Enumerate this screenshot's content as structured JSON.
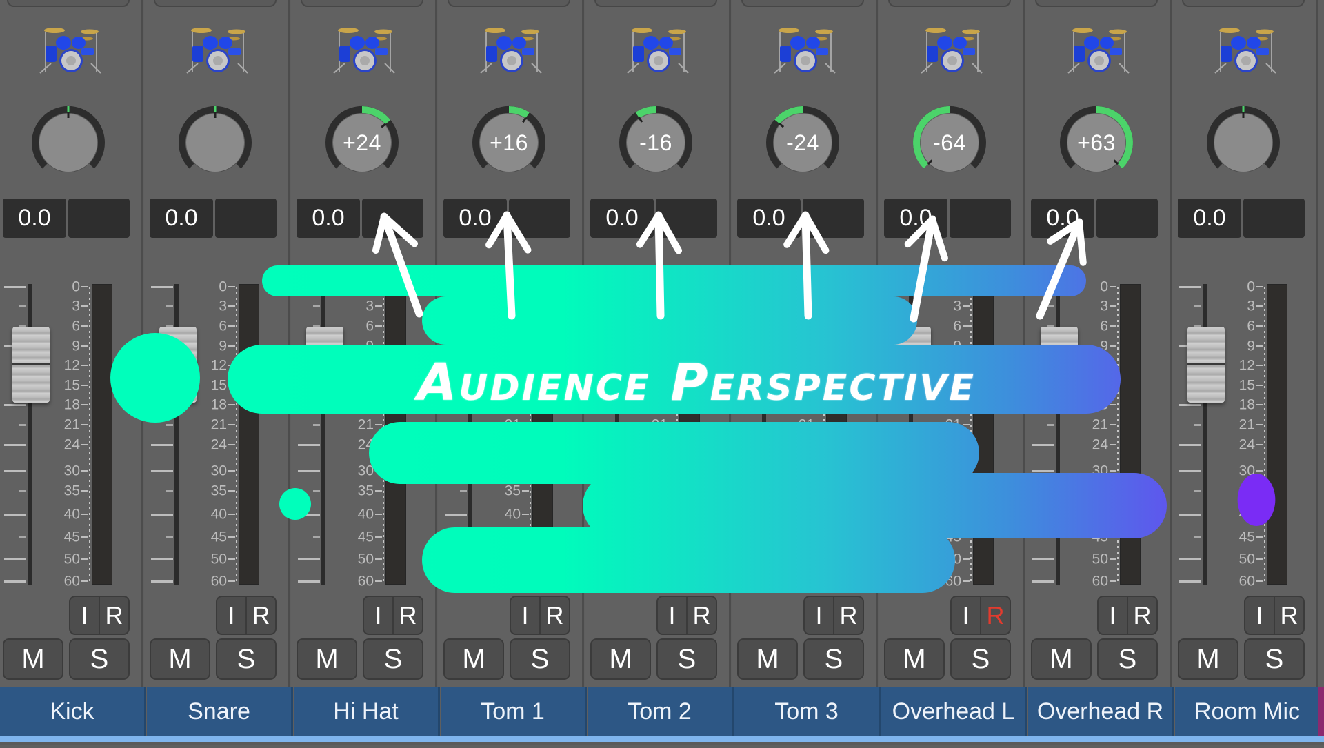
{
  "app": "Audio Mixer",
  "title_overlay": "Audience Perspective",
  "colors": {
    "knob_arc_active": "#4cd36a",
    "knob_arc_track": "#2d2d2d",
    "name_bar": "#2d5785",
    "record_active": "#e23b2e",
    "brush_start": "#00ffbb",
    "brush_end": "#6050f0",
    "dot_purple": "#7a2cf5"
  },
  "scale_labels": [
    "0",
    "3",
    "6",
    "9",
    "12",
    "15",
    "18",
    "21",
    "24",
    "30",
    "35",
    "40",
    "45",
    "50",
    "60"
  ],
  "buttons": {
    "input": "I",
    "record": "R",
    "mute": "M",
    "solo": "S"
  },
  "channels": [
    {
      "name": "Kick",
      "icon": "drum-kit-icon",
      "pan": 0,
      "pan_label": "",
      "volume": "0.0",
      "peak": "",
      "fader_db": 12,
      "record_armed": false
    },
    {
      "name": "Snare",
      "icon": "drum-kit-icon",
      "pan": 0,
      "pan_label": "",
      "volume": "0.0",
      "peak": "",
      "fader_db": 12,
      "record_armed": false
    },
    {
      "name": "Hi Hat",
      "icon": "drum-kit-icon",
      "pan": 24,
      "pan_label": "+24",
      "volume": "0.0",
      "peak": "",
      "fader_db": 12,
      "record_armed": false
    },
    {
      "name": "Tom 1",
      "icon": "drum-kit-icon",
      "pan": 16,
      "pan_label": "+16",
      "volume": "0.0",
      "peak": "",
      "fader_db": 12,
      "record_armed": false
    },
    {
      "name": "Tom 2",
      "icon": "drum-kit-icon",
      "pan": -16,
      "pan_label": "-16",
      "volume": "0.0",
      "peak": "",
      "fader_db": 12,
      "record_armed": false
    },
    {
      "name": "Tom 3",
      "icon": "drum-kit-icon",
      "pan": -24,
      "pan_label": "-24",
      "volume": "0.0",
      "peak": "",
      "fader_db": 12,
      "record_armed": false
    },
    {
      "name": "Overhead L",
      "icon": "drum-kit-icon",
      "pan": -64,
      "pan_label": "-64",
      "volume": "0.0",
      "peak": "",
      "fader_db": 12,
      "record_armed": true
    },
    {
      "name": "Overhead R",
      "icon": "drum-kit-icon",
      "pan": 63,
      "pan_label": "+63",
      "volume": "0.0",
      "peak": "",
      "fader_db": 12,
      "record_armed": false
    },
    {
      "name": "Room Mic",
      "icon": "drum-kit-icon",
      "pan": 0,
      "pan_label": "",
      "volume": "0.0",
      "peak": "",
      "fader_db": 12,
      "record_armed": false
    }
  ]
}
